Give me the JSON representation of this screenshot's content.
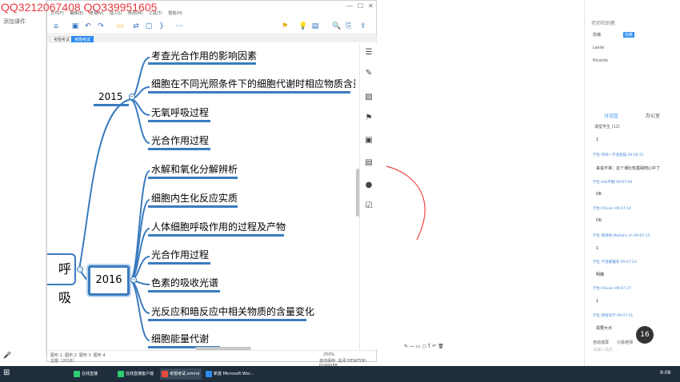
{
  "watermark": "QQ3212067408  QQ339951605",
  "live_left": {
    "add_courseware": "添加课件"
  },
  "xmind": {
    "menus": [
      "文件(F)",
      "编辑(E)",
      "查看(V)",
      "插入(I)",
      "修改(M)",
      "工具(T)",
      "帮助(H)"
    ],
    "tabs": [
      "考题考试",
      "考题考试"
    ],
    "root_topic": "呼吸",
    "year_2015": "2015",
    "year_2016": "2016",
    "topics_2015": [
      "考查光合作用的影响因素",
      "细胞在不同光照条件下的细胞代谢时相应物质含量",
      "无氧呼吸过程",
      "光合作用过程"
    ],
    "topics_2016": [
      "水解和氧化分解辨析",
      "细胞内生化反应实质",
      "人体细胞呼吸作用的过程及产物",
      "光合作用过程",
      "色素的吸收光谱",
      "光反应和暗反应中相关物质的含量变化",
      "细胞能量代谢"
    ],
    "sheet_tabs": [
      "图布 1",
      "图布 2",
      "图布 3",
      "图布 4"
    ],
    "status_left": "主题（2016）",
    "status_right": "自动保存: 关闭   DESKTOP-H2495FB",
    "zoom": "250%"
  },
  "right_panel": {
    "teacher_label": "老师和助教",
    "members": [
      "陈曦",
      "Leslie",
      "Ricardo"
    ],
    "member_badge": "助教",
    "tab_discussion": "讨论区",
    "tab_office": "办公室",
    "filter": "课堂学生 (12)",
    "messages": [
      {
        "meta": "",
        "body": "1"
      },
      {
        "meta": "学生-阿阿一学渣爱猫  09:06:31",
        "body": "来说不准：这个课比较基础吧心中了"
      },
      {
        "meta": "学生-Kiki不翻  09:07:04",
        "body": "OK"
      },
      {
        "meta": "学生-FDvien  09:07:14",
        "body": "OK"
      },
      {
        "meta": "学生-南南栈-MoRalis.ch  09:07:15",
        "body": "1"
      },
      {
        "meta": "学生-学渣最懂考  09:07:23",
        "body": "明确"
      },
      {
        "meta": "学生-FDvien  09:07:27",
        "body": "1"
      },
      {
        "meta": "学生-哈哈同学  09:07:51",
        "body": "需要大点"
      }
    ],
    "auto_scroll": "自动滚屏",
    "only_teacher": "只看老师",
    "input_placeholder": "请输入消息",
    "timer": "16"
  },
  "taskbar": {
    "apps": [
      "在线直播",
      "在线直播客户端",
      "考题考试.xmind",
      "新建 Microsoft Wor..."
    ],
    "time": "9:08"
  },
  "colors": {
    "accent": "#3b7bbf",
    "watermark": "#e8383d",
    "taskbar": "#1f2d3d"
  }
}
